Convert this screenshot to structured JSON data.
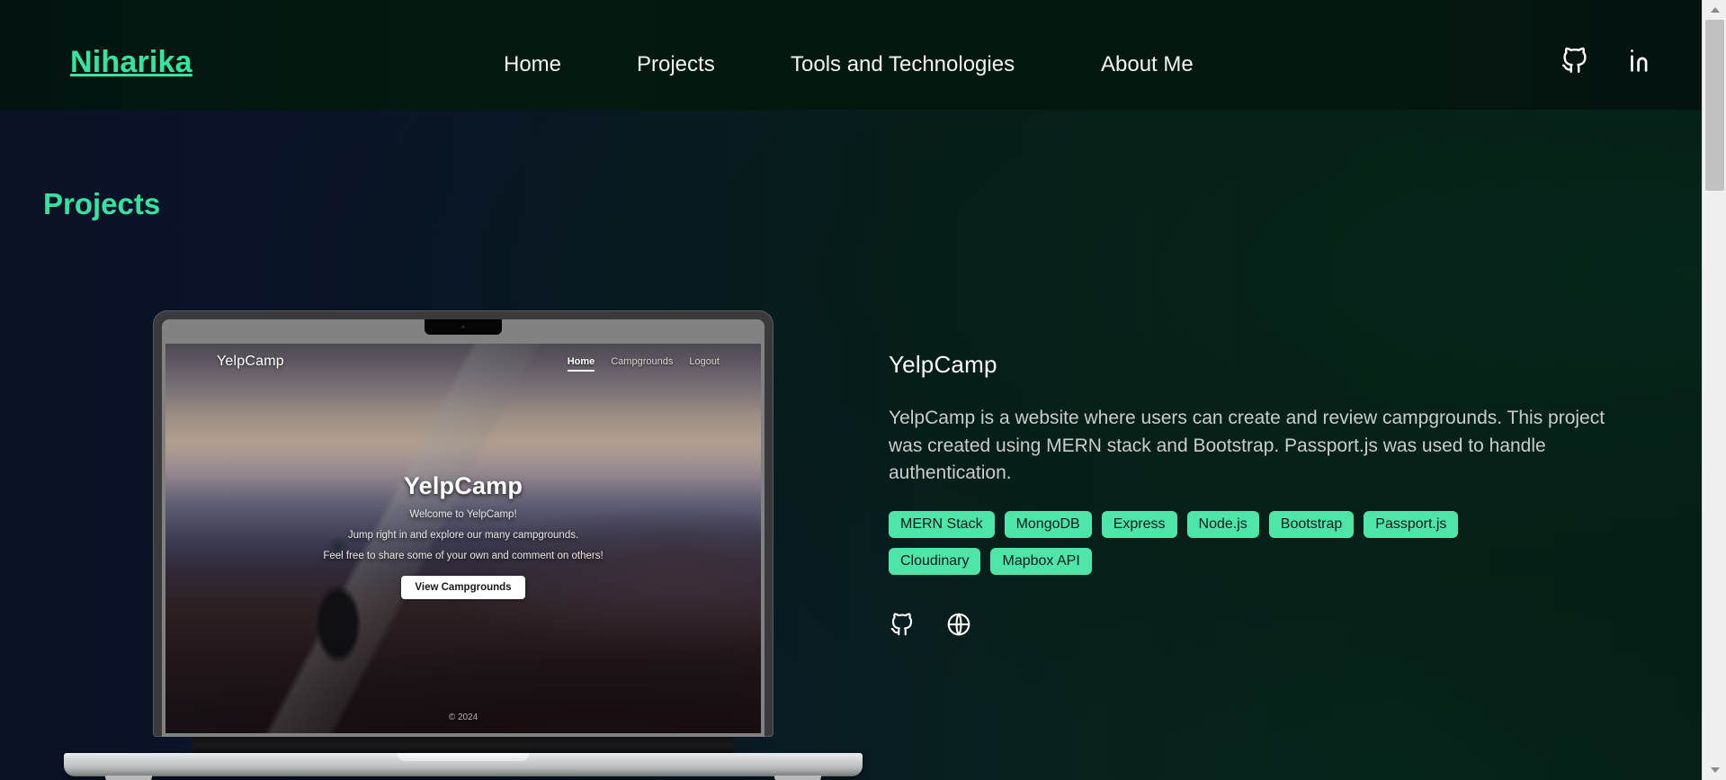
{
  "navbar": {
    "brand": "Niharika",
    "links": [
      {
        "label": "Home"
      },
      {
        "label": "Projects"
      },
      {
        "label": "Tools and Technologies"
      },
      {
        "label": "About Me"
      }
    ],
    "socials": [
      {
        "name": "github-icon",
        "label": "GitHub"
      },
      {
        "name": "linkedin-icon",
        "label": "LinkedIn"
      }
    ]
  },
  "page": {
    "section_title": "Projects"
  },
  "project": {
    "title": "YelpCamp",
    "description": "YelpCamp is a website where users can create and review campgrounds. This project was created using MERN stack and Bootstrap. Passport.js was used to handle authentication.",
    "tags": [
      "MERN Stack",
      "MongoDB",
      "Express",
      "Node.js",
      "Bootstrap",
      "Passport.js",
      "Cloudinary",
      "Mapbox API"
    ],
    "links": [
      {
        "name": "github-icon",
        "label": "GitHub Repository"
      },
      {
        "name": "globe-icon",
        "label": "Live Site"
      }
    ]
  },
  "preview": {
    "brand": "YelpCamp",
    "menu": [
      {
        "label": "Home",
        "active": true
      },
      {
        "label": "Campgrounds",
        "active": false
      },
      {
        "label": "Logout",
        "active": false
      }
    ],
    "hero_title": "YelpCamp",
    "hero_line1": "Welcome to YelpCamp!",
    "hero_line2": "Jump right in and explore our many campgrounds.",
    "hero_line3": "Feel free to share some of your own and comment on others!",
    "hero_button": "View Campgrounds",
    "footer": "© 2024"
  },
  "colors": {
    "accent": "#36e3a0",
    "tag_bg": "#4de5a8",
    "tag_text": "#0f1b20",
    "text_primary": "#ffffff",
    "text_muted": "#c9cdcb"
  }
}
